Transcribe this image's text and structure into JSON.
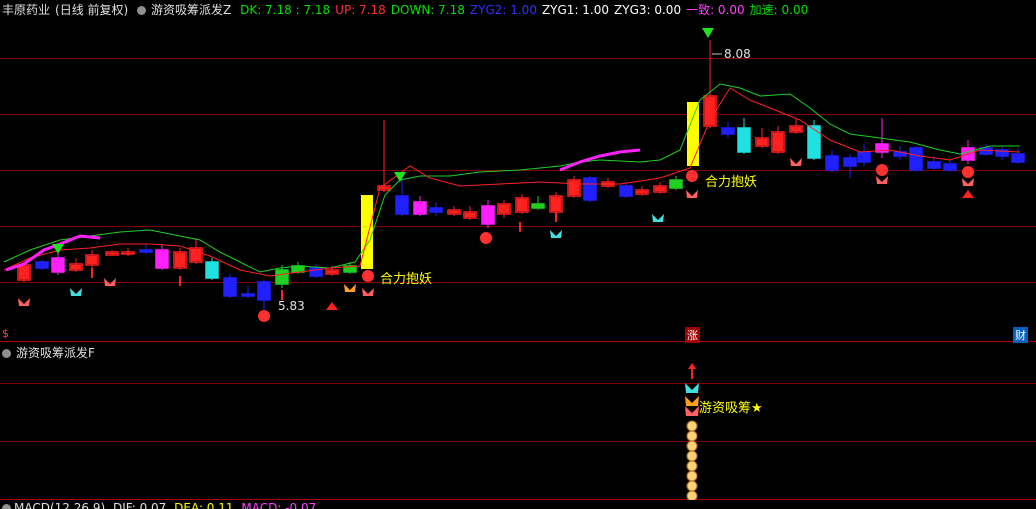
{
  "stock": {
    "name": "丰原药业",
    "period": "(日线 前复权)"
  },
  "main_indicator": {
    "name": "游资吸筹派发Z",
    "values": [
      {
        "label": "DK: 7.18 : 7.18",
        "color": "#00e000"
      },
      {
        "label": "UP: 7.18",
        "color": "#ff3030"
      },
      {
        "label": "DOWN: 7.18",
        "color": "#00e000"
      },
      {
        "label": "ZYG2: 1.00",
        "color": "#3030ff"
      },
      {
        "label": "ZYG1: 1.00",
        "color": "#ffffff"
      },
      {
        "label": "ZYG3: 0.00",
        "color": "#ffffff"
      },
      {
        "label": "一致: 0.00",
        "color": "#ff40ff"
      },
      {
        "label": "加速: 0.00",
        "color": "#00e000"
      }
    ]
  },
  "annotations": {
    "high_price": "8.08",
    "low_price": "5.83",
    "signal_1": "合力抱妖",
    "signal_2": "合力抱妖",
    "sub_signal": "游资吸筹★",
    "bottom_markers": [
      "$",
      "涨",
      "财"
    ]
  },
  "sub_indicator": {
    "name": "游资吸筹派发F"
  },
  "macd": {
    "label": "MACD(12,26,9)",
    "dif": "DIF: 0.07",
    "dea": "DEA: 0.11",
    "macd": "MACD: -0.07"
  },
  "colors": {
    "bull": "#ff3030",
    "bear": "#3030ff",
    "accent_yellow": "#ffff00",
    "grid": "#800000"
  }
}
